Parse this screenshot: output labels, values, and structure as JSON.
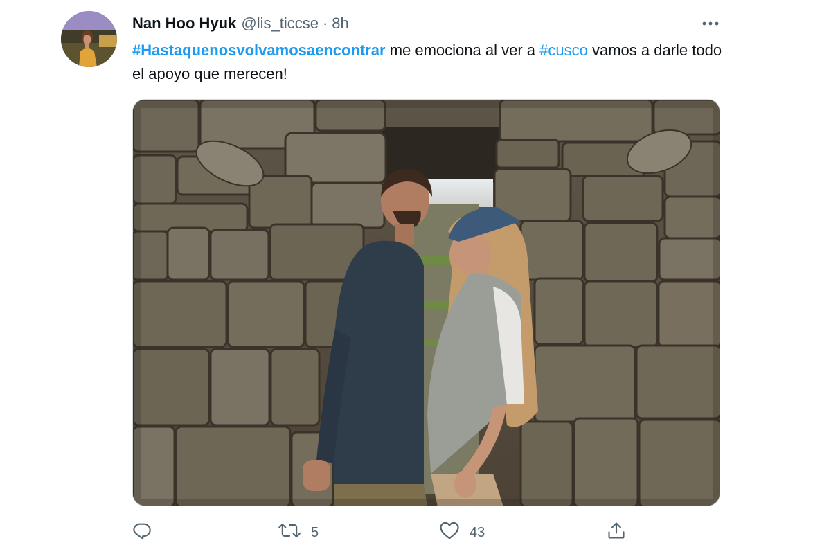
{
  "tweet": {
    "author": {
      "display_name": "Nan Hoo Hyuk",
      "handle": "@lis_ticcse"
    },
    "separator": "·",
    "time": "8h",
    "text": {
      "hashtag1": "#Hastaquenosvolvamosaencontrar",
      "part1": " me emociona al ver a ",
      "hashtag2": "#cusco",
      "part2": " vamos a darle todo el apoyo que merecen!"
    },
    "media": {
      "description_icon": "photo"
    },
    "actions": {
      "reply_icon": "reply-icon",
      "retweet_icon": "retweet-icon",
      "retweet_count": "5",
      "like_icon": "heart-icon",
      "like_count": "43",
      "share_icon": "share-icon"
    },
    "colors": {
      "link": "#1d9bf0",
      "muted": "#536471"
    }
  }
}
